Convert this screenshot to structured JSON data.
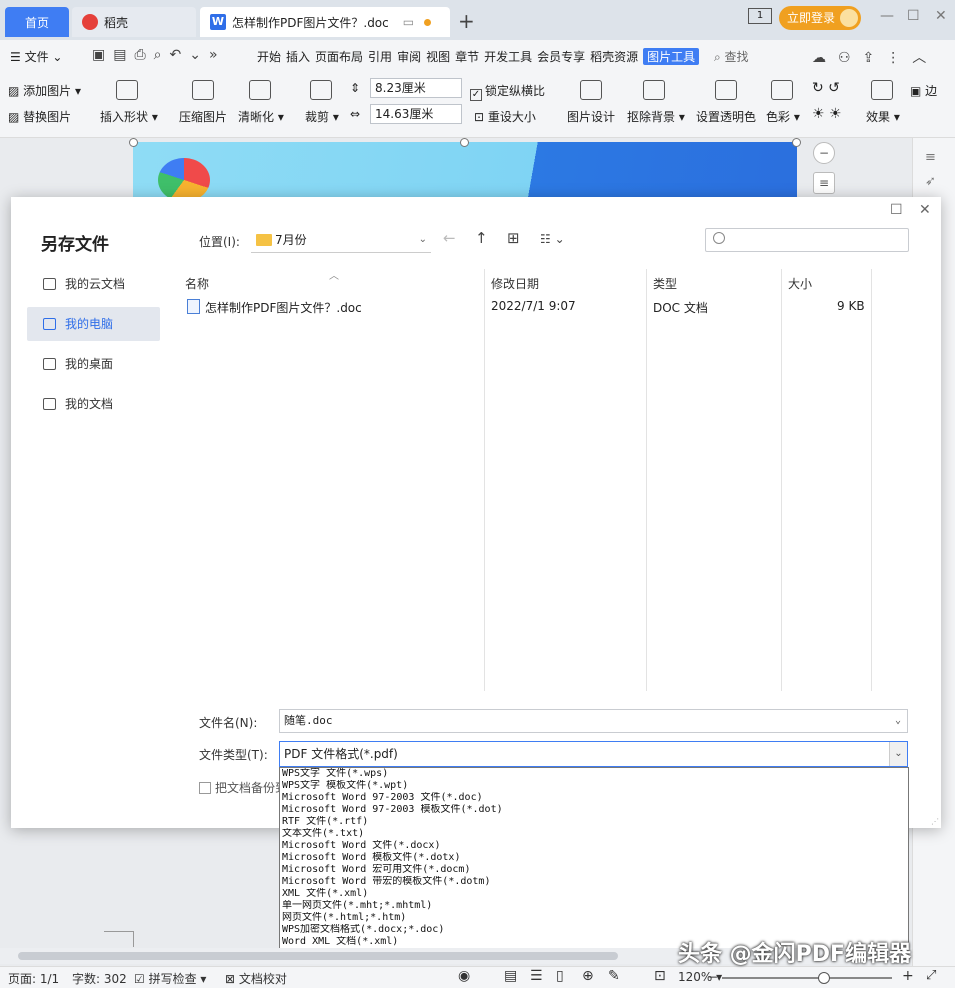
{
  "tabs": {
    "home": "首页",
    "daoke": "稻壳",
    "doc": "怎样制作PDF图片文件？.doc",
    "login": "立即登录"
  },
  "menu": {
    "file": "文件",
    "tabs": [
      "开始",
      "插入",
      "页面布局",
      "引用",
      "审阅",
      "视图",
      "章节",
      "开发工具",
      "会员专享",
      "稻壳资源",
      "图片工具"
    ],
    "search": "查找"
  },
  "ribbon": {
    "add_image": "添加图片",
    "replace_image": "替换图片",
    "insert_shape": "插入形状",
    "compress": "压缩图片",
    "sharpen": "清晰化",
    "crop": "裁剪",
    "height": "8.23厘米",
    "width": "14.63厘米",
    "lock_ratio": "锁定纵横比",
    "reset_size": "重设大小",
    "image_design": "图片设计",
    "remove_bg": "抠除背景",
    "set_transparent": "设置透明色",
    "color": "色彩",
    "effect": "效果",
    "border": "边"
  },
  "dialog": {
    "title": "另存文件",
    "location_label": "位置(I):",
    "location": "7月份",
    "sidebar": [
      "我的云文档",
      "我的电脑",
      "我的桌面",
      "我的文档"
    ],
    "columns": {
      "name": "名称",
      "date": "修改日期",
      "type": "类型",
      "size": "大小"
    },
    "file": {
      "name": "怎样制作PDF图片文件？.doc",
      "date": "2022/7/1 9:07",
      "type": "DOC 文档",
      "size": "9 KB"
    },
    "filename_label": "文件名(N):",
    "filename": "随笔.doc",
    "filetype_label": "文件类型(T):",
    "filetype": "PDF 文件格式(*.pdf)",
    "backup": "把文档备份到"
  },
  "dropdown": [
    "WPS文字 文件(*.wps)",
    "WPS文字 模板文件(*.wpt)",
    "Microsoft Word 97-2003 文件(*.doc)",
    "Microsoft Word 97-2003 模板文件(*.dot)",
    "RTF 文件(*.rtf)",
    "文本文件(*.txt)",
    "Microsoft Word 文件(*.docx)",
    "Microsoft Word 模板文件(*.dotx)",
    "Microsoft Word 宏可用文件(*.docm)",
    "Microsoft Word 带宏的模板文件(*.dotm)",
    "XML 文件(*.xml)",
    "单一网页文件(*.mht;*.mhtml)",
    "网页文件(*.html;*.htm)",
    "WPS加密文档格式(*.docx;*.doc)",
    "Word XML 文档(*.xml)",
    "PDF 文件格式(*.pdf)"
  ],
  "status": {
    "page": "页面: 1/1",
    "words": "字数: 302",
    "spell": "拼写检查",
    "proof": "文档校对",
    "zoom": "120%",
    "zoom_level": 0.6
  },
  "watermark": "头条 @金闪PDF编辑器"
}
